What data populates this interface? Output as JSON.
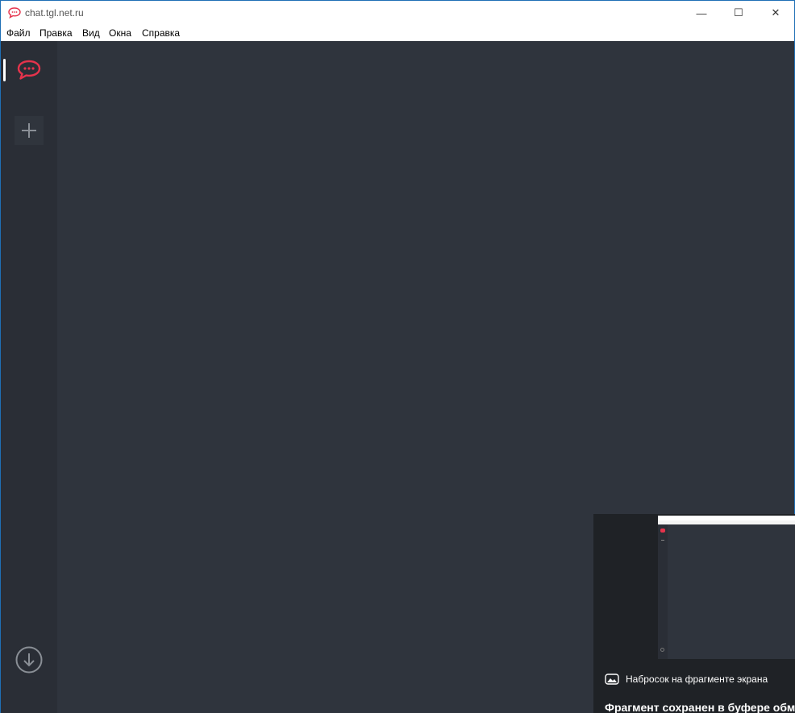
{
  "window": {
    "title": "chat.tgl.net.ru",
    "controls": {
      "minimize": "—",
      "maximize": "☐",
      "close": "✕"
    }
  },
  "menubar": {
    "items": [
      "Файл",
      "Правка",
      "Вид",
      "Окна",
      "Справка"
    ]
  },
  "sidebar": {
    "server_icon": "rocket-chat-logo-icon",
    "add_icon": "plus-icon",
    "download_icon": "download-circle-icon"
  },
  "snip_notification": {
    "caption": "Набросок на фрагменте экрана",
    "message": "Фрагмент сохранен в буфере обм"
  },
  "colors": {
    "accent": "#e5334c",
    "main_bg": "#2f343d",
    "sidebar_bg": "#2a2e36"
  }
}
